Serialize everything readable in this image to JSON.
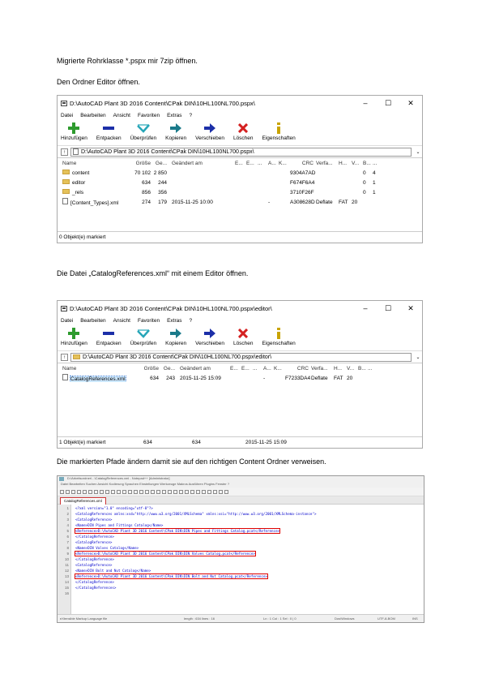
{
  "paragraphs": {
    "p1": "Migrierte Rohrklasse *.pspx mir 7zip öffnen.",
    "p2": "Den Ordner Editor öffnen.",
    "p3": "Die Datei „CatalogReferences.xml“ mit einem Editor öffnen.",
    "p4": "Die markierten Pfade ändern damit sie auf den richtigen Content Ordner verweisen."
  },
  "menu": [
    "Datei",
    "Bearbeiten",
    "Ansicht",
    "Favoriten",
    "Extras",
    "?"
  ],
  "toolbar": [
    {
      "label": "Hinzufügen",
      "icon": "plus-icon"
    },
    {
      "label": "Entpacken",
      "icon": "minus-icon"
    },
    {
      "label": "Überprüfen",
      "icon": "check-icon"
    },
    {
      "label": "Kopieren",
      "icon": "copy-arrow-icon"
    },
    {
      "label": "Verschieben",
      "icon": "move-arrow-icon"
    },
    {
      "label": "Löschen",
      "icon": "delete-x-icon"
    },
    {
      "label": "Eigenschaften",
      "icon": "info-icon"
    }
  ],
  "colors": {
    "plus": "#2e9b2e",
    "minus": "#1c2fa8",
    "check": "#27a6b8",
    "copy": "#1a7a8a",
    "move": "#1c2fa8",
    "delete": "#d42020",
    "info": "#c9a400"
  },
  "win1": {
    "title": "D:\\AutoCAD Plant 3D 2016 Content\\CPak DIN\\10HL100NL700.pspx\\",
    "address": "D:\\AutoCAD Plant 3D 2016 Content\\CPak DIN\\10HL100NL700.pspx\\",
    "headers": [
      "Name",
      "Größe",
      "Ge...",
      "Geändert am",
      "E...",
      "E...",
      "...",
      "A...",
      "K...",
      "CRC",
      "Verfa...",
      "H...",
      "V...",
      "B...",
      "..."
    ],
    "rows": [
      {
        "name": "content",
        "size": "70 102",
        "packed": "2 850",
        "modified": "",
        "attr": "",
        "crc": "9304A7AD",
        "method": "",
        "host": "",
        "v": "",
        "b": "0",
        "x": "4"
      },
      {
        "name": "editor",
        "size": "634",
        "packed": "244",
        "modified": "",
        "attr": "",
        "crc": "F674F6A4",
        "method": "",
        "host": "",
        "v": "",
        "b": "0",
        "x": "1"
      },
      {
        "name": "_rels",
        "size": "856",
        "packed": "356",
        "modified": "",
        "attr": "",
        "crc": "3710F26F",
        "method": "",
        "host": "",
        "v": "",
        "b": "0",
        "x": "1"
      },
      {
        "name": "[Content_Types].xml",
        "size": "274",
        "packed": "179",
        "modified": "2015-11-25 10:00",
        "attr": "-",
        "crc": "A308628D",
        "method": "Deflate",
        "host": "FAT",
        "v": "20",
        "b": "",
        "x": ""
      }
    ],
    "status": "0 Objekt(e) markiert"
  },
  "win2": {
    "title": "D:\\AutoCAD Plant 3D 2016 Content\\CPak DIN\\10HL100NL700.pspx\\editor\\",
    "address": "D:\\AutoCAD Plant 3D 2016 Content\\CPak DIN\\10HL100NL700.pspx\\editor\\",
    "headers": [
      "Name",
      "Größe",
      "Ge...",
      "Geändert am",
      "E...",
      "E...",
      "...",
      "A...",
      "K...",
      "CRC",
      "Verfa...",
      "H...",
      "V...",
      "B...",
      "..."
    ],
    "rows": [
      {
        "name": "CatalogReferences.xml",
        "size": "634",
        "packed": "243",
        "modified": "2015-11-25 15:09",
        "attr": "-",
        "crc": "F7233DA4",
        "method": "Deflate",
        "host": "FAT",
        "v": "20"
      }
    ],
    "status": {
      "sel": "1 Objekt(e) markiert",
      "size": "634",
      "size2": "634",
      "date": "2015-11-25 15:09"
    }
  },
  "editor": {
    "title": "D:\\Arbeitsordner\\...\\CatalogReferences.xml - Notepad++ [Administrator]",
    "menu": "Datei  Bearbeiten  Suchen  Ansicht  Kodierung  Sprachen  Einstellungen  Werkzeuge  Makros  Ausführen  Plugins  Fenster  ?",
    "tab": "CatalogReferences.xml",
    "lines": [
      "<?xml version=\"1.0\" encoding=\"utf-8\"?>",
      "<CatalogReferences xmlns:xsd=\"http://www.w3.org/2001/XMLSchema\" xmlns:xsi=\"http://www.w3.org/2001/XMLSchema-instance\">",
      "  <CatalogReference>",
      "    <Name>DIN Pipes and Fittings Catalog</Name>",
      "    <Reference>D:\\AutoCAD Plant 3D 2016 Content\\CPak DIN\\DIN Pipes and Fittings Catalog.pcat</Reference>",
      "  </CatalogReference>",
      "  <CatalogReference>",
      "    <Name>DIN Valves Catalog</Name>",
      "    <Reference>D:\\AutoCAD Plant 3D 2016 Content\\CPak DIN\\DIN Valves Catalog.pcat</Reference>",
      "  </CatalogReference>",
      "  <CatalogReference>",
      "    <Name>DIN Bolt and Nut Catalog</Name>",
      "    <Reference>D:\\AutoCAD Plant 3D 2016 Content\\CPak DIN\\DIN Bolt and Nut Catalog.pcat</Reference>",
      "  </CatalogReference>",
      "</CatalogReferences>",
      ""
    ],
    "status": {
      "lang": "eXtensible Markup Language file",
      "length": "length : 634    lines : 16",
      "pos": "Ln : 1    Col : 1    Sel : 0 | 0",
      "eol": "Dos\\Windows",
      "enc": "UTF-8-BOM",
      "ins": "INS"
    }
  }
}
